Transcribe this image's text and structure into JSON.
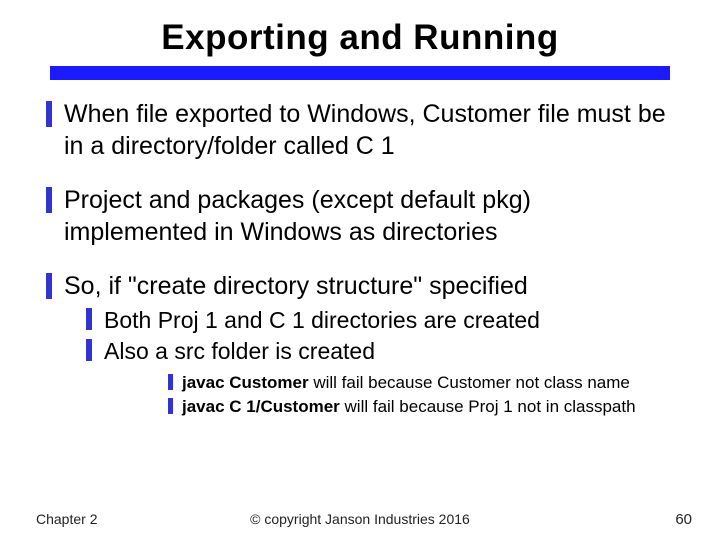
{
  "title": "Exporting and Running",
  "bullets": [
    "When file exported to Windows, Customer file must be in a directory/folder called C 1",
    "Project and packages (except default pkg) implemented in Windows as directories",
    "So, if \"create directory structure\" specified"
  ],
  "sub_bullets": [
    "Both Proj 1 and C 1 directories are created",
    "Also a src folder is created"
  ],
  "subsub": [
    {
      "code": "javac Customer",
      "rest": " will fail because Customer not class name"
    },
    {
      "code": "javac C 1/Customer",
      "rest": " will fail because Proj 1 not in classpath"
    }
  ],
  "footer": {
    "left": "Chapter 2",
    "center": "© copyright Janson Industries 2016",
    "right": "60"
  }
}
